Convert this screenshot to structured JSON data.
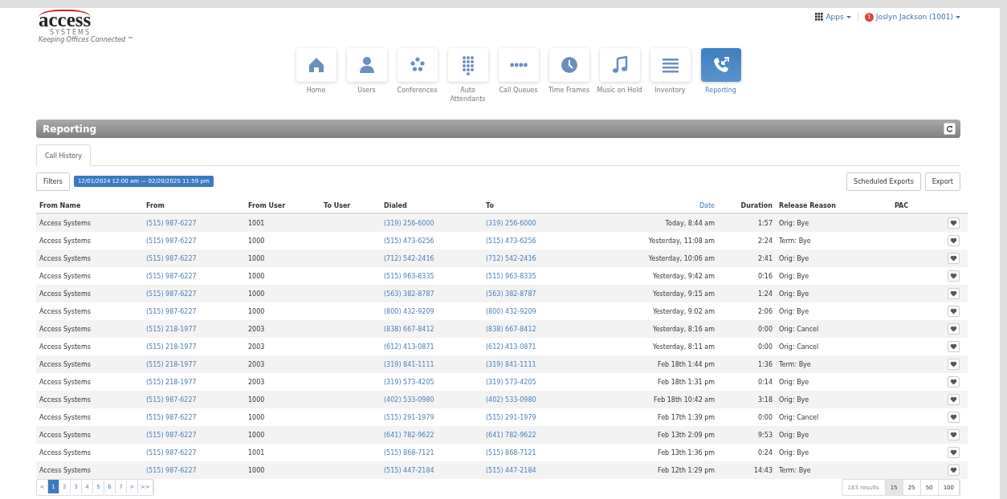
{
  "logo": {
    "wordmark": "access",
    "subtitle": "SYSTEMS",
    "tagline": "Keeping Offices Connected ™"
  },
  "top_menu": {
    "apps": "Apps",
    "badge": "1",
    "user": "Joslyn Jackson (1001)"
  },
  "nav": [
    {
      "label": "Home",
      "kind": "home",
      "selected": false
    },
    {
      "label": "Users",
      "kind": "user",
      "selected": false
    },
    {
      "label": "Conferences",
      "kind": "conference",
      "selected": false
    },
    {
      "label": "Auto Attendants",
      "kind": "keypad",
      "selected": false
    },
    {
      "label": "Call Queues",
      "kind": "queue",
      "selected": false
    },
    {
      "label": "Time Frames",
      "kind": "clock",
      "selected": false
    },
    {
      "label": "Music on Hold",
      "kind": "music",
      "selected": false
    },
    {
      "label": "Inventory",
      "kind": "list",
      "selected": false
    },
    {
      "label": "Reporting",
      "kind": "phone",
      "selected": true
    }
  ],
  "panel": {
    "title": "Reporting"
  },
  "tabs": [
    {
      "label": "Call History",
      "selected": true
    }
  ],
  "filters": {
    "button": "Filters",
    "range": "12/01/2024 12:00 am — 02/20/2025 11:59 pm"
  },
  "actions": [
    "Scheduled Exports",
    "Export"
  ],
  "table": {
    "columns": [
      {
        "label": "From Name",
        "sorted": false
      },
      {
        "label": "From",
        "sorted": false
      },
      {
        "label": "From User",
        "sorted": false
      },
      {
        "label": "To User",
        "sorted": false
      },
      {
        "label": "Dialed",
        "sorted": false
      },
      {
        "label": "To",
        "sorted": false
      },
      {
        "label": "Date",
        "sorted": true
      },
      {
        "label": "Duration",
        "sorted": false
      },
      {
        "label": "Release Reason",
        "sorted": false
      },
      {
        "label": "PAC",
        "sorted": false
      }
    ],
    "rows": [
      [
        "Access Systems",
        "(515) 987-6227",
        "1001",
        "",
        "(319) 256-6000",
        "(319) 256-6000",
        "Today, 8:44 am",
        "1:57",
        "Orig: Bye",
        ""
      ],
      [
        "Access Systems",
        "(515) 987-6227",
        "1000",
        "",
        "(515) 473-6256",
        "(515) 473-6256",
        "Yesterday, 11:08 am",
        "2:24",
        "Term: Bye",
        ""
      ],
      [
        "Access Systems",
        "(515) 987-6227",
        "1000",
        "",
        "(712) 542-2416",
        "(712) 542-2416",
        "Yesterday, 10:06 am",
        "2:41",
        "Orig: Bye",
        ""
      ],
      [
        "Access Systems",
        "(515) 987-6227",
        "1000",
        "",
        "(515) 963-8335",
        "(515) 963-8335",
        "Yesterday, 9:42 am",
        "0:16",
        "Orig: Bye",
        ""
      ],
      [
        "Access Systems",
        "(515) 987-6227",
        "1000",
        "",
        "(563) 382-8787",
        "(563) 382-8787",
        "Yesterday, 9:15 am",
        "1:24",
        "Orig: Bye",
        ""
      ],
      [
        "Access Systems",
        "(515) 987-6227",
        "1000",
        "",
        "(800) 432-9209",
        "(800) 432-9209",
        "Yesterday, 9:02 am",
        "2:06",
        "Orig: Bye",
        ""
      ],
      [
        "Access Systems",
        "(515) 218-1977",
        "2003",
        "",
        "(838) 667-8412",
        "(838) 667-8412",
        "Yesterday, 8:16 am",
        "0:00",
        "Orig: Cancel",
        ""
      ],
      [
        "Access Systems",
        "(515) 218-1977",
        "2003",
        "",
        "(612) 413-0871",
        "(612) 413-0871",
        "Yesterday, 8:11 am",
        "0:00",
        "Orig: Cancel",
        ""
      ],
      [
        "Access Systems",
        "(515) 218-1977",
        "2003",
        "",
        "(319) 841-1111",
        "(319) 841-1111",
        "Feb 18th 1:44 pm",
        "1:36",
        "Term: Bye",
        ""
      ],
      [
        "Access Systems",
        "(515) 218-1977",
        "2003",
        "",
        "(319) 573-4205",
        "(319) 573-4205",
        "Feb 18th 1:31 pm",
        "0:14",
        "Orig: Bye",
        ""
      ],
      [
        "Access Systems",
        "(515) 987-6227",
        "1000",
        "",
        "(402) 533-0980",
        "(402) 533-0980",
        "Feb 18th 10:42 am",
        "3:18",
        "Orig: Bye",
        ""
      ],
      [
        "Access Systems",
        "(515) 987-6227",
        "1000",
        "",
        "(515) 291-1979",
        "(515) 291-1979",
        "Feb 17th 1:39 pm",
        "0:00",
        "Orig: Cancel",
        ""
      ],
      [
        "Access Systems",
        "(515) 987-6227",
        "1000",
        "",
        "(641) 782-9622",
        "(641) 782-9622",
        "Feb 13th 2:09 pm",
        "9:53",
        "Orig: Bye",
        ""
      ],
      [
        "Access Systems",
        "(515) 987-6227",
        "1001",
        "",
        "(515) 868-7121",
        "(515) 868-7121",
        "Feb 13th 1:36 pm",
        "0:24",
        "Orig: Bye",
        ""
      ],
      [
        "Access Systems",
        "(515) 987-6227",
        "1000",
        "",
        "(515) 447-2184",
        "(515) 447-2184",
        "Feb 12th 1:29 pm",
        "14:43",
        "Term: Bye",
        ""
      ]
    ]
  },
  "pagination": [
    {
      "label": "<",
      "selected": false
    },
    {
      "label": "1",
      "selected": true
    },
    {
      "label": "2",
      "selected": false
    },
    {
      "label": "3",
      "selected": false
    },
    {
      "label": "4",
      "selected": false
    },
    {
      "label": "5",
      "selected": false
    },
    {
      "label": "6",
      "selected": false
    },
    {
      "label": "7",
      "selected": false
    },
    {
      "label": ">",
      "selected": false
    },
    {
      "label": ">>",
      "selected": false
    }
  ],
  "results": "183 results",
  "page_sizes": [
    {
      "label": "15",
      "selected": true
    },
    {
      "label": "25",
      "selected": false
    },
    {
      "label": "50",
      "selected": false
    },
    {
      "label": "100",
      "selected": false
    }
  ]
}
